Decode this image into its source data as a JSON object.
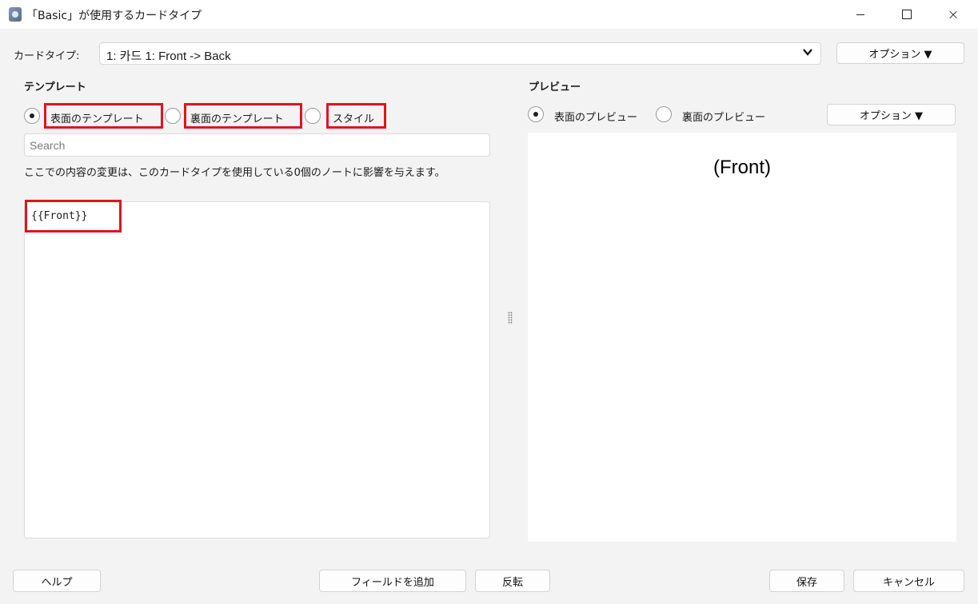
{
  "window": {
    "title": "「Basic」が使用するカードタイプ",
    "minimize": "minimize",
    "maximize": "maximize",
    "close": "×"
  },
  "card_type": {
    "label": "カードタイプ:",
    "selected": "1: 카드 1: Front -> Back",
    "options_button": "オプション ▼"
  },
  "template": {
    "heading": "テンプレート",
    "radios": [
      {
        "label": "表面のテンプレート",
        "checked": true
      },
      {
        "label": "裏面のテンプレート",
        "checked": false
      },
      {
        "label": "スタイル",
        "checked": false
      }
    ],
    "search_placeholder": "Search",
    "notice": "ここでの内容の変更は、このカードタイプを使用している0個のノートに影響を与えます。",
    "editor_content": "{{Front}}"
  },
  "preview": {
    "heading": "プレビュー",
    "radios": [
      {
        "label": "表面のプレビュー",
        "checked": true
      },
      {
        "label": "裏面のプレビュー",
        "checked": false
      }
    ],
    "options_button": "オプション ▼",
    "content": "(Front)"
  },
  "footer": {
    "help": "ヘルプ",
    "add_field": "フィールドを追加",
    "flip": "反転",
    "save": "保存",
    "cancel": "キャンセル"
  },
  "colors": {
    "highlight": "#e0141e",
    "background": "#f3f3f3"
  }
}
